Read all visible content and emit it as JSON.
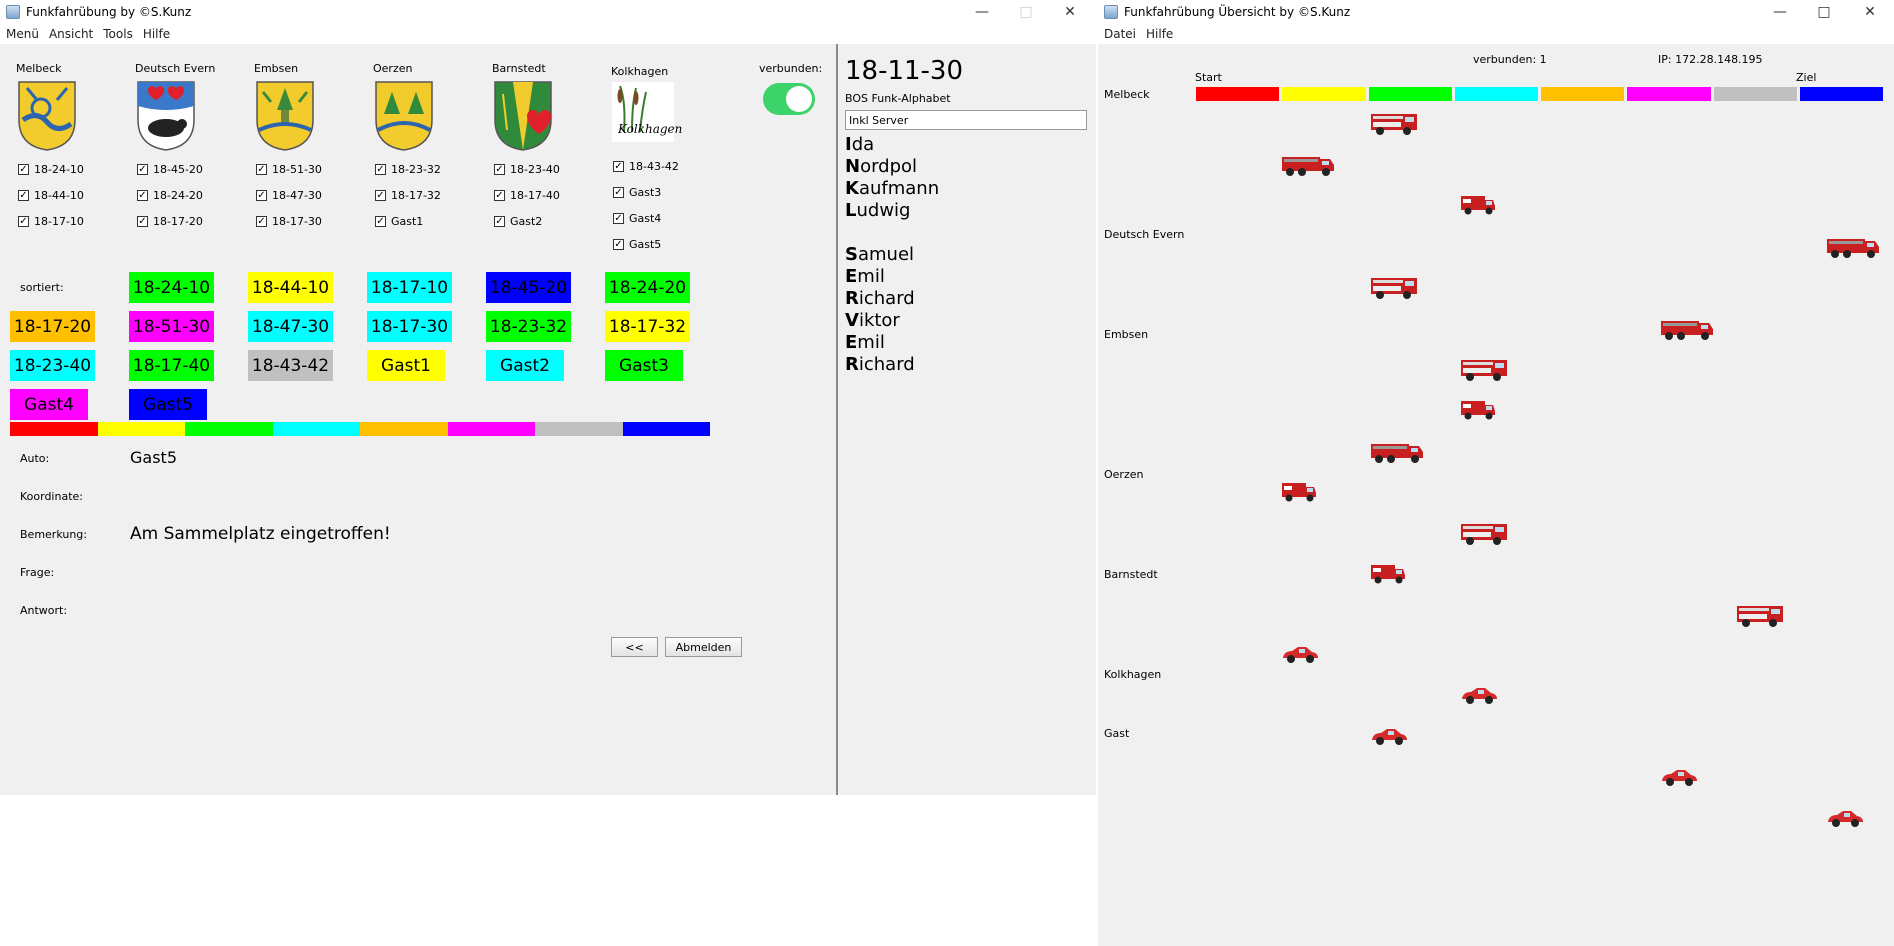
{
  "left_window": {
    "title": "Funkfahrübung by ©S.Kunz",
    "menu": [
      "Menü",
      "Ansicht",
      "Tools",
      "Hilfe"
    ],
    "connected_label": "verbunden:",
    "towns": [
      {
        "name": "Melbeck",
        "checks": [
          "18-24-10",
          "18-44-10",
          "18-17-10"
        ]
      },
      {
        "name": "Deutsch Evern",
        "checks": [
          "18-45-20",
          "18-24-20",
          "18-17-20"
        ]
      },
      {
        "name": "Embsen",
        "checks": [
          "18-51-30",
          "18-47-30",
          "18-17-30"
        ]
      },
      {
        "name": "Oerzen",
        "checks": [
          "18-23-32",
          "18-17-32",
          "Gast1"
        ]
      },
      {
        "name": "Barnstedt",
        "checks": [
          "18-23-40",
          "18-17-40",
          "Gast2"
        ]
      },
      {
        "name": "Kolkhagen",
        "checks": [
          "18-43-42",
          "Gast3",
          "Gast4",
          "Gast5"
        ]
      }
    ],
    "kolkhagen_logo_text": "Kolkhagen",
    "sorted_label": "sortiert:",
    "sorted_tiles": [
      {
        "text": "18-24-10",
        "color": "#00ff00"
      },
      {
        "text": "18-44-10",
        "color": "#ffff00"
      },
      {
        "text": "18-17-10",
        "color": "#00ffff"
      },
      {
        "text": "18-45-20",
        "color": "#0000ff"
      },
      {
        "text": "18-24-20",
        "color": "#00ff00"
      },
      {
        "text": "18-17-20",
        "color": "#ffc000"
      },
      {
        "text": "18-51-30",
        "color": "#ff00ff"
      },
      {
        "text": "18-47-30",
        "color": "#00ffff"
      },
      {
        "text": "18-17-30",
        "color": "#00ffff"
      },
      {
        "text": "18-23-32",
        "color": "#00ff00"
      },
      {
        "text": "18-17-32",
        "color": "#ffff00"
      },
      {
        "text": "18-23-40",
        "color": "#00ffff"
      },
      {
        "text": "18-17-40",
        "color": "#00ff00"
      },
      {
        "text": "18-43-42",
        "color": "#c0c0c0"
      },
      {
        "text": "Gast1",
        "color": "#ffff00"
      },
      {
        "text": "Gast2",
        "color": "#00ffff"
      },
      {
        "text": "Gast3",
        "color": "#00ff00"
      },
      {
        "text": "Gast4",
        "color": "#ff00ff"
      },
      {
        "text": "Gast5",
        "color": "#0000ff"
      }
    ],
    "color_bar": [
      "#ff0000",
      "#ffff00",
      "#00ff00",
      "#00ffff",
      "#ffc000",
      "#ff00ff",
      "#c0c0c0",
      "#0000ff"
    ],
    "fields": {
      "auto_label": "Auto:",
      "auto_value": "Gast5",
      "koordinate_label": "Koordinate:",
      "koordinate_value": "",
      "bemerkung_label": "Bemerkung:",
      "bemerkung_value": "Am Sammelplatz eingetroffen!",
      "frage_label": "Frage:",
      "frage_value": "",
      "antwort_label": "Antwort:",
      "antwort_value": ""
    },
    "back_button": "<<",
    "logout_button": "Abmelden",
    "side_panel": {
      "callsign": "18-11-30",
      "alphabet_label": "BOS Funk-Alphabet",
      "server_field": "Inkl Server",
      "words_group1": [
        {
          "first": "I",
          "rest": "da"
        },
        {
          "first": "N",
          "rest": "ordpol"
        },
        {
          "first": "K",
          "rest": "aufmann"
        },
        {
          "first": "L",
          "rest": "udwig"
        }
      ],
      "words_group2": [
        {
          "first": "S",
          "rest": "amuel"
        },
        {
          "first": "E",
          "rest": "mil"
        },
        {
          "first": "R",
          "rest": "ichard"
        },
        {
          "first": "V",
          "rest": "iktor"
        },
        {
          "first": "E",
          "rest": "mil"
        },
        {
          "first": "R",
          "rest": "ichard"
        }
      ]
    }
  },
  "right_window": {
    "title": "Funkfahrübung Übersicht by ©S.Kunz",
    "menu": [
      "Datei",
      "Hilfe"
    ],
    "connected_text": "verbunden: 1",
    "ip_text": "IP: 172.28.148.195",
    "start_label": "Start",
    "goal_label": "Ziel",
    "color_bar": [
      "#ff0000",
      "#ffff00",
      "#00ff00",
      "#00ffff",
      "#ffc000",
      "#ff00ff",
      "#c0c0c0",
      "#0000ff"
    ],
    "row_labels": [
      "Melbeck",
      "Deutsch Evern",
      "Embsen",
      "Oerzen",
      "Barnstedt",
      "Kolkhagen",
      "Gast"
    ],
    "vehicles": [
      {
        "kind": "truck",
        "progress": 0.28
      },
      {
        "kind": "tanker",
        "progress": 0.15
      },
      {
        "kind": "van",
        "progress": 0.41
      },
      {
        "kind": "tanker",
        "progress": 0.94
      },
      {
        "kind": "truck",
        "progress": 0.28
      },
      {
        "kind": "tanker",
        "progress": 0.7
      },
      {
        "kind": "truck",
        "progress": 0.41
      },
      {
        "kind": "van",
        "progress": 0.41
      },
      {
        "kind": "tanker",
        "progress": 0.28
      },
      {
        "kind": "van",
        "progress": 0.15
      },
      {
        "kind": "truck",
        "progress": 0.41
      },
      {
        "kind": "van",
        "progress": 0.28
      },
      {
        "kind": "truck",
        "progress": 0.81
      },
      {
        "kind": "car",
        "progress": 0.15
      },
      {
        "kind": "car",
        "progress": 0.41
      },
      {
        "kind": "car",
        "progress": 0.28
      },
      {
        "kind": "car",
        "progress": 0.7
      },
      {
        "kind": "car",
        "progress": 0.94
      }
    ]
  }
}
